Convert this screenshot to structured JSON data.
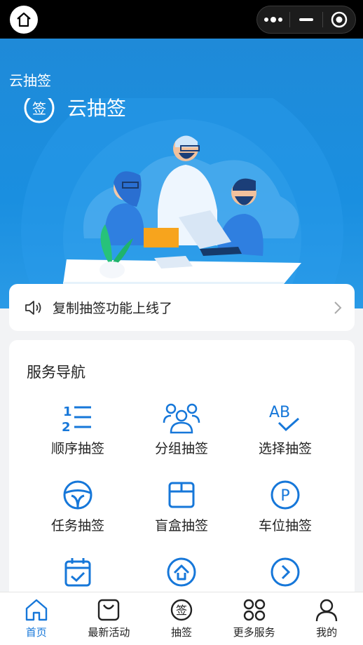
{
  "header": {
    "title": "云抽签",
    "logo_text": "云抽签"
  },
  "notice": {
    "text": "复制抽签功能上线了"
  },
  "services": {
    "title": "服务导航",
    "items": [
      {
        "label": "顺序抽签",
        "icon": "ordered-list-icon"
      },
      {
        "label": "分组抽签",
        "icon": "group-icon"
      },
      {
        "label": "选择抽签",
        "icon": "ab-check-icon"
      },
      {
        "label": "任务抽签",
        "icon": "steering-wheel-icon"
      },
      {
        "label": "盲盒抽签",
        "icon": "box-icon"
      },
      {
        "label": "车位抽签",
        "icon": "parking-icon"
      },
      {
        "label": "",
        "icon": "calendar-check-icon"
      },
      {
        "label": "",
        "icon": "upload-circle-icon"
      },
      {
        "label": "",
        "icon": "arrow-right-circle-icon"
      }
    ]
  },
  "tabbar": {
    "items": [
      {
        "label": "首页",
        "icon": "home-icon",
        "active": true
      },
      {
        "label": "最新活动",
        "icon": "bag-icon"
      },
      {
        "label": "抽签",
        "icon": "draw-seal-icon",
        "glyph": "签"
      },
      {
        "label": "更多服务",
        "icon": "apps-icon"
      },
      {
        "label": "我的",
        "icon": "user-icon"
      }
    ]
  },
  "colors": {
    "accent": "#1677d9",
    "hero_bg": "#1a8fe0",
    "icon_blue": "#1677d9"
  }
}
